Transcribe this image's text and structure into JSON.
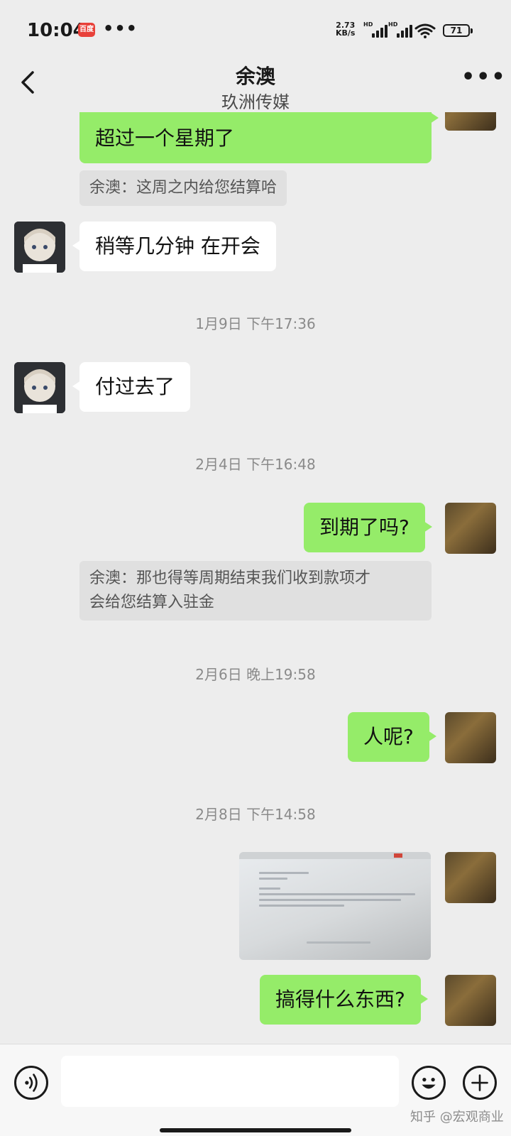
{
  "status_bar": {
    "time": "10:04",
    "app_badge": "百度",
    "dots": "•••",
    "net_speed_value": "2.73",
    "net_speed_unit": "KB/s",
    "signal_label": "HD",
    "battery": "71"
  },
  "header": {
    "title": "余澳",
    "subtitle": "玖洲传媒",
    "more": "•••"
  },
  "messages": [
    {
      "text": "超过一个星期了"
    },
    {
      "quote": "余澳：这周之内给您结算哈"
    },
    {
      "text": "稍等几分钟 在开会"
    },
    {
      "timestamp": "1月9日 下午17:36"
    },
    {
      "text": "付过去了"
    },
    {
      "timestamp": "2月4日 下午16:48"
    },
    {
      "text": "到期了吗?"
    },
    {
      "quote_line1": "余澳：那也得等周期结束我们收到款项才",
      "quote_line2": "会给您结算入驻金"
    },
    {
      "timestamp": "2月6日 晚上19:58"
    },
    {
      "text": "人呢?"
    },
    {
      "timestamp": "2月8日 下午14:58"
    },
    {
      "image": "screenshot-image"
    },
    {
      "text": "搞得什么东西?"
    }
  ],
  "input_bar": {
    "watermark": "知乎 @宏观商业"
  },
  "colors": {
    "background": "#ededed",
    "sent_bubble": "#95ec69",
    "received_bubble": "#ffffff",
    "quote_bg": "#e0e0e0"
  },
  "icons": [
    "back-icon",
    "more-icon",
    "voice-icon",
    "emoji-icon",
    "plus-icon",
    "wifi-icon",
    "battery-icon",
    "signal-icon"
  ]
}
